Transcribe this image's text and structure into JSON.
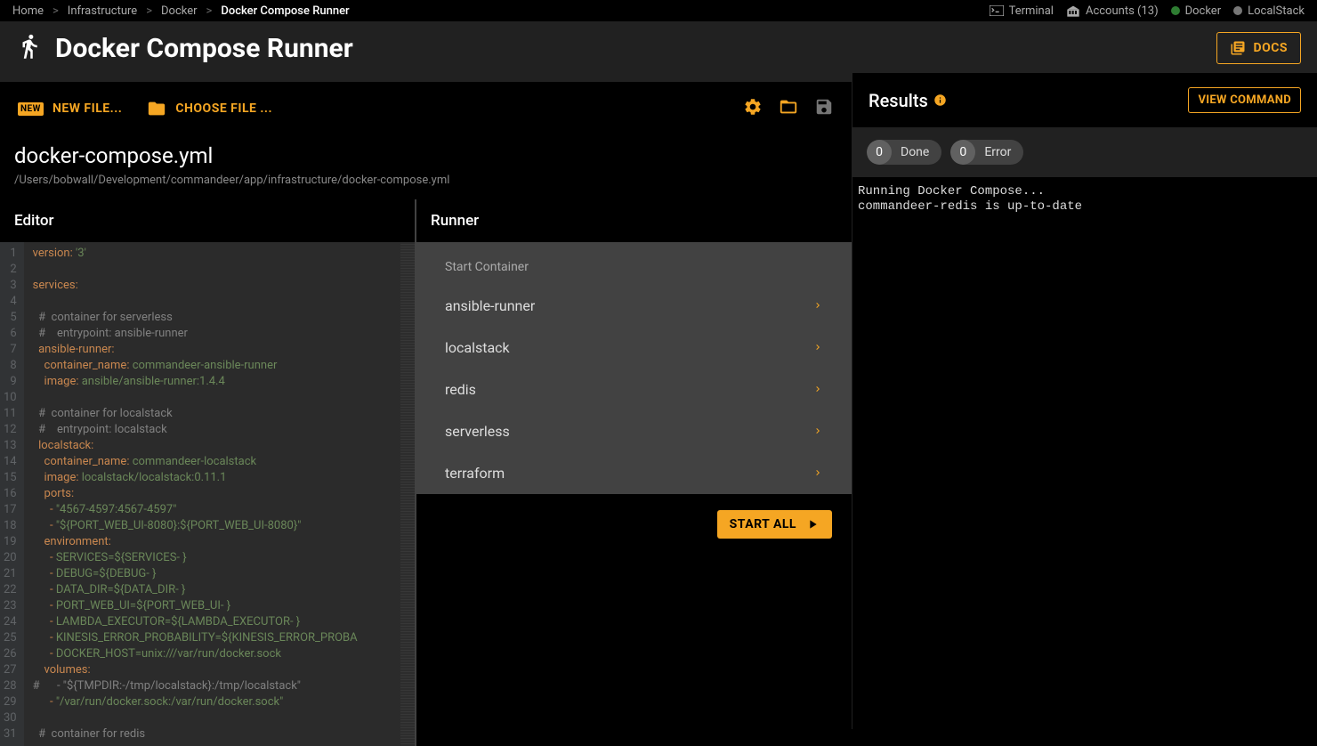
{
  "breadcrumbs": [
    "Home",
    "Infrastructure",
    "Docker",
    "Docker Compose Runner"
  ],
  "topright": {
    "terminal": "Terminal",
    "accounts": "Accounts (13)",
    "docker": "Docker",
    "localstack": "LocalStack"
  },
  "header": {
    "title": "Docker Compose Runner",
    "docs_btn": "DOCS"
  },
  "toolbar": {
    "new_file": "NEW FILE...",
    "choose_file": "CHOOSE FILE ...",
    "new_badge": "NEW"
  },
  "file": {
    "name": "docker-compose.yml",
    "path": "/Users/bobwall/Development/commandeer/app/infrastructure/docker-compose.yml"
  },
  "editor": {
    "title": "Editor"
  },
  "runner": {
    "title": "Runner",
    "section_label": "Start Container",
    "items": [
      "ansible-runner",
      "localstack",
      "redis",
      "serverless",
      "terraform"
    ],
    "start_all": "START ALL"
  },
  "results": {
    "title": "Results",
    "view_cmd": "VIEW COMMAND",
    "done_count": "0",
    "done_label": "Done",
    "error_count": "0",
    "error_label": "Error",
    "log": "Running Docker Compose...\ncommandeer-redis is up-to-date"
  },
  "code_lines": [
    {
      "n": 1,
      "t": [
        [
          "k",
          "version"
        ],
        [
          "p",
          ": "
        ],
        [
          "s",
          "'3'"
        ]
      ]
    },
    {
      "n": 2,
      "t": []
    },
    {
      "n": 3,
      "t": [
        [
          "k",
          "services"
        ],
        [
          "p",
          ":"
        ]
      ]
    },
    {
      "n": 4,
      "t": []
    },
    {
      "n": 5,
      "t": [
        [
          "i",
          1
        ],
        [
          "c",
          "#  container for serverless"
        ]
      ]
    },
    {
      "n": 6,
      "t": [
        [
          "i",
          1
        ],
        [
          "c",
          "#    entrypoint: ansible-runner"
        ]
      ]
    },
    {
      "n": 7,
      "t": [
        [
          "i",
          1
        ],
        [
          "k",
          "ansible-runner"
        ],
        [
          "p",
          ":"
        ]
      ]
    },
    {
      "n": 8,
      "t": [
        [
          "i",
          2
        ],
        [
          "k",
          "container_name"
        ],
        [
          "p",
          ": "
        ],
        [
          "x",
          "commandeer-ansible-runner"
        ]
      ]
    },
    {
      "n": 9,
      "t": [
        [
          "i",
          2
        ],
        [
          "k",
          "image"
        ],
        [
          "p",
          ": "
        ],
        [
          "x",
          "ansible/ansible-runner:1.4.4"
        ]
      ]
    },
    {
      "n": 10,
      "t": []
    },
    {
      "n": 11,
      "t": [
        [
          "i",
          1
        ],
        [
          "c",
          "#  container for localstack"
        ]
      ]
    },
    {
      "n": 12,
      "t": [
        [
          "i",
          1
        ],
        [
          "c",
          "#    entrypoint: localstack"
        ]
      ]
    },
    {
      "n": 13,
      "t": [
        [
          "i",
          1
        ],
        [
          "k",
          "localstack"
        ],
        [
          "p",
          ":"
        ]
      ]
    },
    {
      "n": 14,
      "t": [
        [
          "i",
          2
        ],
        [
          "k",
          "container_name"
        ],
        [
          "p",
          ": "
        ],
        [
          "x",
          "commandeer-localstack"
        ]
      ]
    },
    {
      "n": 15,
      "t": [
        [
          "i",
          2
        ],
        [
          "k",
          "image"
        ],
        [
          "p",
          ": "
        ],
        [
          "x",
          "localstack/localstack:0.11.1"
        ]
      ]
    },
    {
      "n": 16,
      "t": [
        [
          "i",
          2
        ],
        [
          "k",
          "ports"
        ],
        [
          "p",
          ":"
        ]
      ]
    },
    {
      "n": 17,
      "t": [
        [
          "i",
          3
        ],
        [
          "p",
          "- "
        ],
        [
          "s",
          "\"4567-4597:4567-4597\""
        ]
      ]
    },
    {
      "n": 18,
      "t": [
        [
          "i",
          3
        ],
        [
          "p",
          "- "
        ],
        [
          "s",
          "\"${PORT_WEB_UI-8080}:${PORT_WEB_UI-8080}\""
        ]
      ]
    },
    {
      "n": 19,
      "t": [
        [
          "i",
          2
        ],
        [
          "k",
          "environment"
        ],
        [
          "p",
          ":"
        ]
      ]
    },
    {
      "n": 20,
      "t": [
        [
          "i",
          3
        ],
        [
          "p",
          "- "
        ],
        [
          "x",
          "SERVICES=${SERVICES- }"
        ]
      ]
    },
    {
      "n": 21,
      "t": [
        [
          "i",
          3
        ],
        [
          "p",
          "- "
        ],
        [
          "x",
          "DEBUG=${DEBUG- }"
        ]
      ]
    },
    {
      "n": 22,
      "t": [
        [
          "i",
          3
        ],
        [
          "p",
          "- "
        ],
        [
          "x",
          "DATA_DIR=${DATA_DIR- }"
        ]
      ]
    },
    {
      "n": 23,
      "t": [
        [
          "i",
          3
        ],
        [
          "p",
          "- "
        ],
        [
          "x",
          "PORT_WEB_UI=${PORT_WEB_UI- }"
        ]
      ]
    },
    {
      "n": 24,
      "t": [
        [
          "i",
          3
        ],
        [
          "p",
          "- "
        ],
        [
          "x",
          "LAMBDA_EXECUTOR=${LAMBDA_EXECUTOR- }"
        ]
      ]
    },
    {
      "n": 25,
      "t": [
        [
          "i",
          3
        ],
        [
          "p",
          "- "
        ],
        [
          "x",
          "KINESIS_ERROR_PROBABILITY=${KINESIS_ERROR_PROBA"
        ]
      ]
    },
    {
      "n": 26,
      "t": [
        [
          "i",
          3
        ],
        [
          "p",
          "- "
        ],
        [
          "x",
          "DOCKER_HOST=unix:///var/run/docker.sock"
        ]
      ]
    },
    {
      "n": 27,
      "t": [
        [
          "i",
          2
        ],
        [
          "k",
          "volumes"
        ],
        [
          "p",
          ":"
        ]
      ]
    },
    {
      "n": 28,
      "t": [
        [
          "c",
          "#      - \"${TMPDIR:-/tmp/localstack}:/tmp/localstack\""
        ]
      ]
    },
    {
      "n": 29,
      "t": [
        [
          "i",
          3
        ],
        [
          "p",
          "- "
        ],
        [
          "s",
          "\"/var/run/docker.sock:/var/run/docker.sock\""
        ]
      ]
    },
    {
      "n": 30,
      "t": []
    },
    {
      "n": 31,
      "t": [
        [
          "i",
          1
        ],
        [
          "c",
          "#  container for redis"
        ]
      ]
    }
  ]
}
